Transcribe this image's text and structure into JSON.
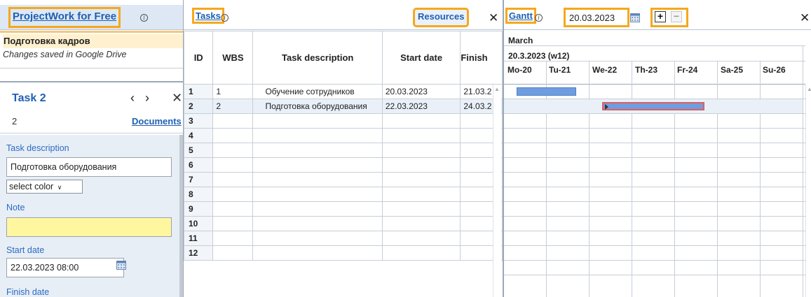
{
  "left": {
    "app_title": "ProjectWork for Free",
    "project_name": "Подготовка кадров",
    "project_status": "Changes saved in Google Drive",
    "task": {
      "title": "Task 2",
      "number": "2",
      "documents_label": "Documents",
      "prev_glyph": "‹",
      "next_glyph": "›",
      "close_glyph": "✕"
    },
    "form": {
      "description_label": "Task description",
      "description_value": "Подготовка оборудования",
      "color_select": "select color",
      "note_label": "Note",
      "note_value": "",
      "start_label": "Start date",
      "start_value": "22.03.2023 08:00",
      "finish_label": "Finish date"
    }
  },
  "middle": {
    "tasks_label": "Tasks",
    "resources_label": "Resources",
    "close_glyph": "✕",
    "columns": [
      "ID",
      "WBS",
      "Task description",
      "Start date",
      "Finish"
    ],
    "rows": [
      {
        "id": "1",
        "wbs": "1",
        "desc": "Обучение сотрудников",
        "start": "20.03.2023",
        "finish": "21.03.2"
      },
      {
        "id": "2",
        "wbs": "2",
        "desc": "Подготовка оборудования",
        "start": "22.03.2023",
        "finish": "24.03.2"
      },
      {
        "id": "3",
        "wbs": "",
        "desc": "",
        "start": "",
        "finish": ""
      },
      {
        "id": "4",
        "wbs": "",
        "desc": "",
        "start": "",
        "finish": ""
      },
      {
        "id": "5",
        "wbs": "",
        "desc": "",
        "start": "",
        "finish": ""
      },
      {
        "id": "6",
        "wbs": "",
        "desc": "",
        "start": "",
        "finish": ""
      },
      {
        "id": "7",
        "wbs": "",
        "desc": "",
        "start": "",
        "finish": ""
      },
      {
        "id": "8",
        "wbs": "",
        "desc": "",
        "start": "",
        "finish": ""
      },
      {
        "id": "9",
        "wbs": "",
        "desc": "",
        "start": "",
        "finish": ""
      },
      {
        "id": "10",
        "wbs": "",
        "desc": "",
        "start": "",
        "finish": ""
      },
      {
        "id": "11",
        "wbs": "",
        "desc": "",
        "start": "",
        "finish": ""
      },
      {
        "id": "12",
        "wbs": "",
        "desc": "",
        "start": "",
        "finish": ""
      }
    ]
  },
  "gantt": {
    "gantt_label": "Gantt",
    "date_value": "20.03.2023",
    "zoom_in": "+",
    "zoom_out": "−",
    "close_glyph": "✕",
    "month": "March",
    "week": "20.3.2023 (w12)",
    "days": [
      "Mo-20",
      "Tu-21",
      "We-22",
      "Th-23",
      "Fr-24",
      "Sa-25",
      "Su-26"
    ],
    "bars": [
      {
        "row": 1,
        "start_day": 0.3,
        "end_day": 1.7,
        "color": "#6f9de0"
      },
      {
        "row": 2,
        "start_day": 2.3,
        "end_day": 4.7,
        "color": "#6f9de0",
        "border": "#e0605a"
      }
    ]
  },
  "colors": {
    "accent": "#1e5fb3",
    "highlight": "#f5a81c",
    "header_bg": "#dde8f4",
    "form_bg": "#e8eef6",
    "note_bg": "#fff7a0"
  }
}
